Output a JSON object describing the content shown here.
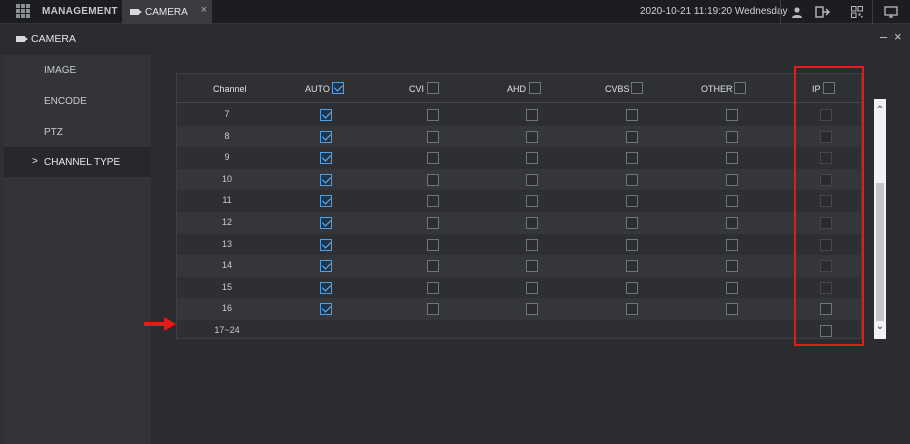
{
  "topbar": {
    "management_label": "MANAGEMENT",
    "active_tab_label": "CAMERA",
    "close_glyph": "×",
    "datetime": "2020-10-21 11:19:20 Wednesday",
    "icons": [
      "user-icon",
      "logout-icon",
      "qr-code-icon",
      "monitor-icon"
    ]
  },
  "window": {
    "title": "CAMERA",
    "minimize_glyph": "–",
    "close_glyph": "×"
  },
  "sidebar": {
    "items": [
      {
        "label": "IMAGE",
        "active": false
      },
      {
        "label": "ENCODE",
        "active": false
      },
      {
        "label": "PTZ",
        "active": false
      },
      {
        "label": "CHANNEL TYPE",
        "active": true
      }
    ],
    "active_marker": ">"
  },
  "table": {
    "headers": {
      "channel": "Channel",
      "auto": "AUTO",
      "cvi": "CVI",
      "ahd": "AHD",
      "cvbs": "CVBS",
      "other": "OTHER",
      "ip": "IP"
    },
    "header_checks": {
      "auto": true,
      "cvi": false,
      "ahd": false,
      "cvbs": false,
      "other": false,
      "ip": false
    },
    "rows": [
      {
        "channel": "7",
        "auto": true,
        "ip_enabled": false
      },
      {
        "channel": "8",
        "auto": true,
        "ip_enabled": false
      },
      {
        "channel": "9",
        "auto": true,
        "ip_enabled": false
      },
      {
        "channel": "10",
        "auto": true,
        "ip_enabled": false
      },
      {
        "channel": "11",
        "auto": true,
        "ip_enabled": false
      },
      {
        "channel": "12",
        "auto": true,
        "ip_enabled": false
      },
      {
        "channel": "13",
        "auto": true,
        "ip_enabled": false
      },
      {
        "channel": "14",
        "auto": true,
        "ip_enabled": false
      },
      {
        "channel": "15",
        "auto": true,
        "ip_enabled": false
      },
      {
        "channel": "16",
        "auto": true,
        "ip_enabled": true
      },
      {
        "channel": "17~24",
        "auto": null,
        "ip_enabled": true
      }
    ]
  },
  "colors": {
    "accent_check": "#66b7ff",
    "annotation_red": "#e21b1b"
  }
}
